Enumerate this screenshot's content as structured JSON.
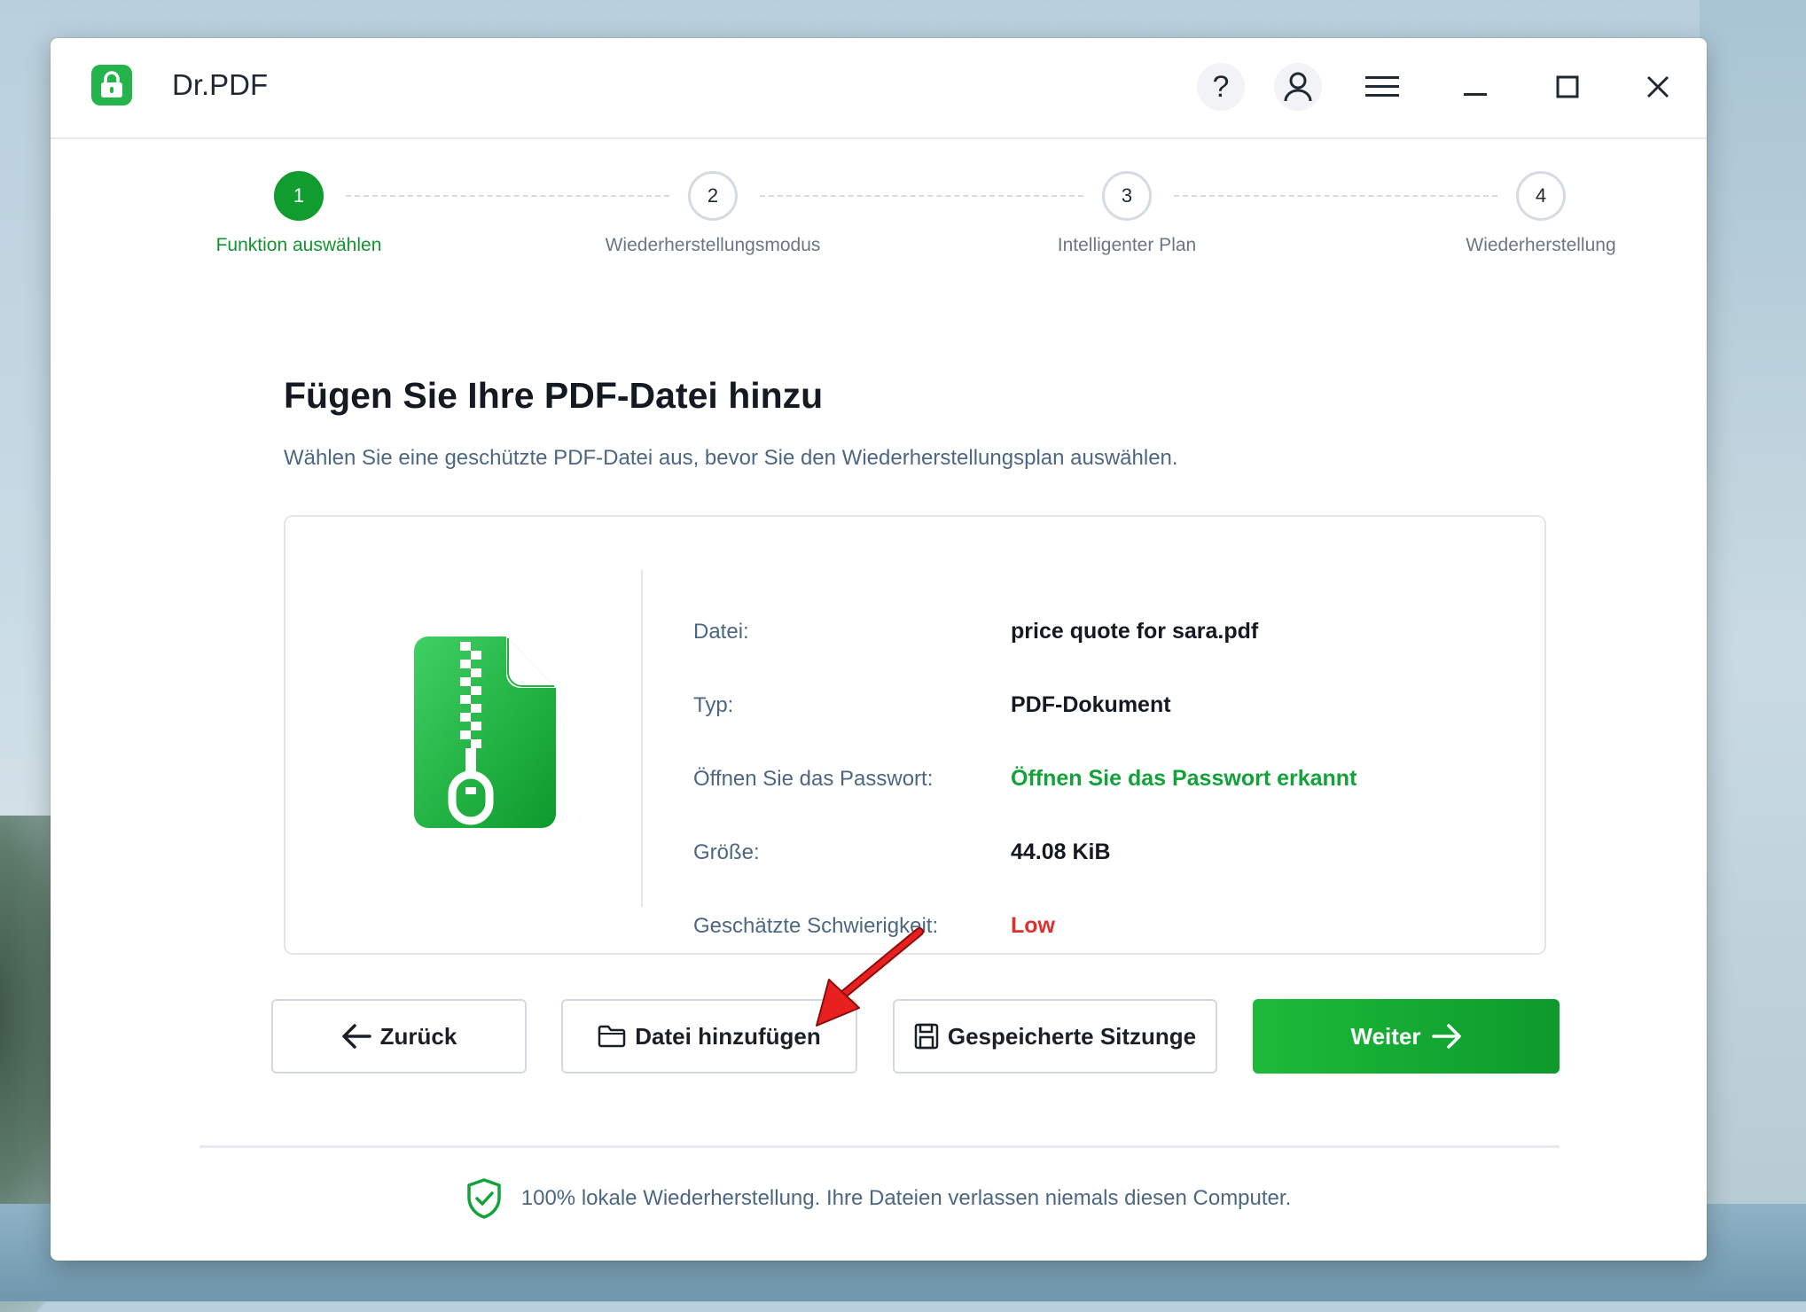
{
  "app": {
    "title": "Dr.PDF",
    "accent_color": "#109c2e",
    "icons": {
      "logo": "lock-icon",
      "help": "question-mark-icon",
      "account": "user-icon",
      "menu": "hamburger-menu-icon",
      "minimize": "minimize-icon",
      "maximize": "maximize-icon",
      "close": "close-icon"
    },
    "help_glyph": "?"
  },
  "stepper": {
    "steps": [
      {
        "number": "1",
        "label": "Funktion auswählen",
        "active": true
      },
      {
        "number": "2",
        "label": "Wiederherstellungsmodus",
        "active": false
      },
      {
        "number": "3",
        "label": "Intelligenter Plan",
        "active": false
      },
      {
        "number": "4",
        "label": "Wiederherstellung",
        "active": false
      }
    ]
  },
  "main": {
    "heading": "Fügen Sie Ihre PDF-Datei hinzu",
    "subheading": "Wählen Sie eine geschützte PDF-Datei aus, bevor Sie den Wiederherstellungsplan auswählen."
  },
  "file_info": {
    "icon": "zipped-file-icon",
    "rows": [
      {
        "label": "Datei:",
        "value": "price quote for sara.pdf",
        "color": "#141a22"
      },
      {
        "label": "Typ:",
        "value": "PDF-Dokument",
        "color": "#141a22"
      },
      {
        "label": "Öffnen Sie das Passwort:",
        "value": "Öffnen Sie das Passwort erkannt",
        "color": "#13a23a"
      },
      {
        "label": "Größe:",
        "value": "44.08 KiB",
        "color": "#141a22"
      },
      {
        "label": "Geschätzte Schwierigkeit:",
        "value": "Low",
        "color": "#e02f2f"
      }
    ]
  },
  "actions": {
    "back_label": "Zurück",
    "add_file_label": "Datei hinzufügen",
    "saved_session_label": "Gespeicherte Sitzunge",
    "next_label": "Weiter"
  },
  "footer": {
    "note": "100% lokale Wiederherstellung. Ihre Dateien verlassen niemals diesen Computer."
  }
}
